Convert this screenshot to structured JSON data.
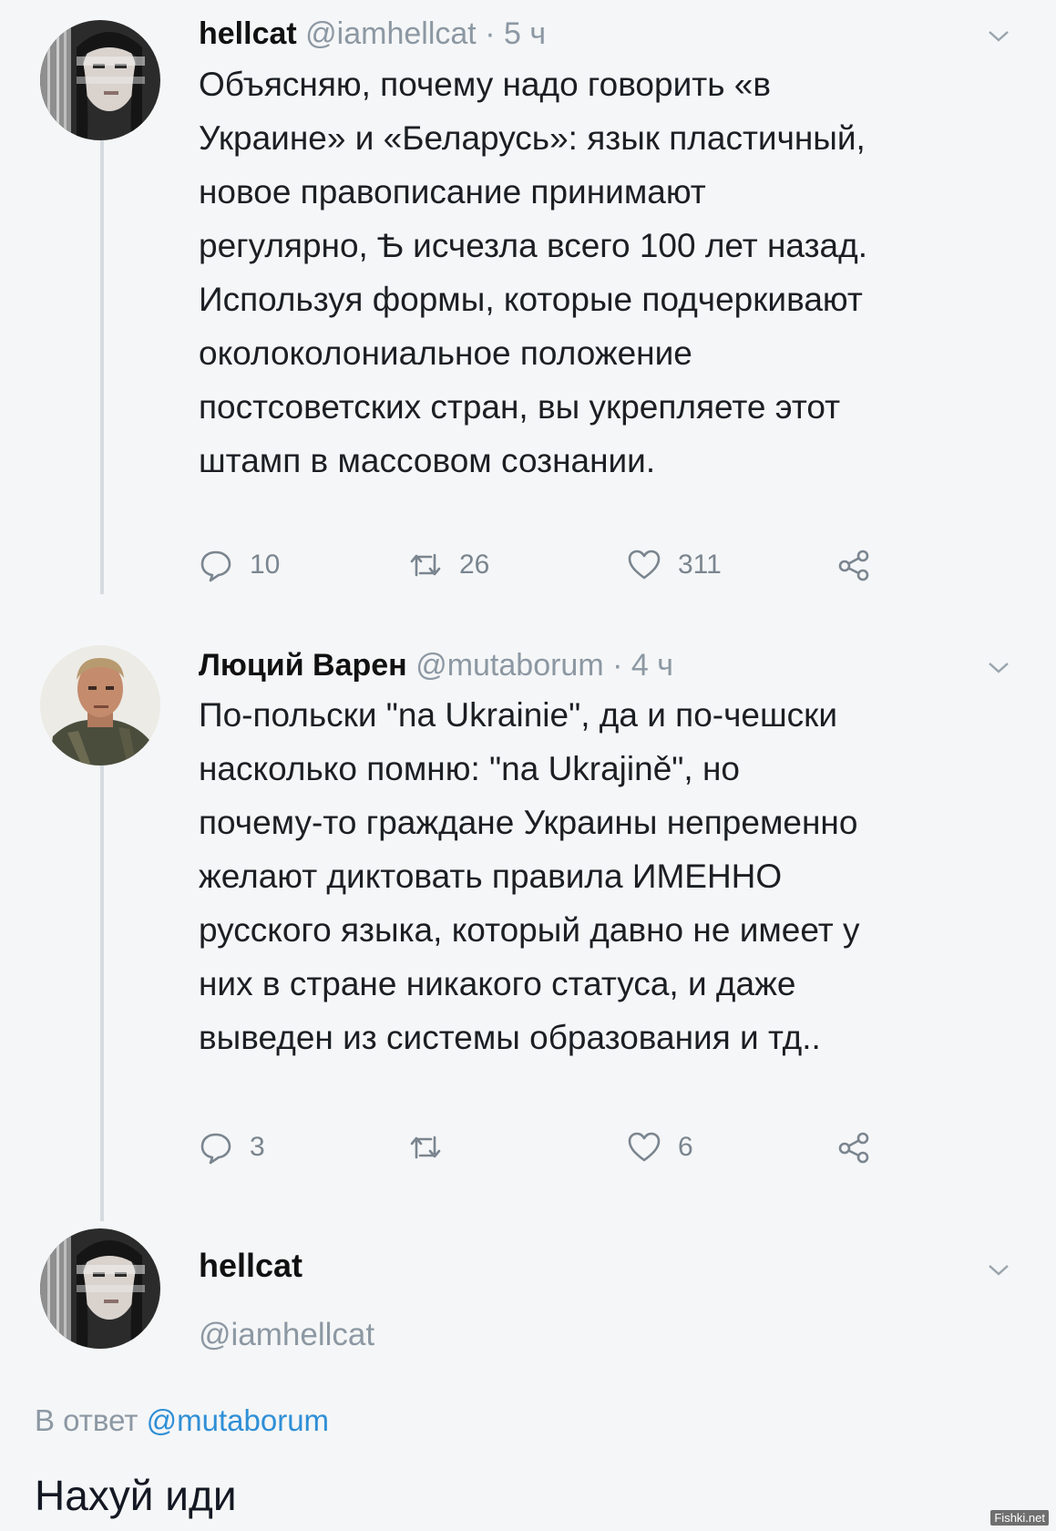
{
  "tweets": [
    {
      "name": "hellcat",
      "handle": "@iamhellcat",
      "dot": "·",
      "time": "5 ч",
      "lines": [
        "Объясняю, почему надо говорить «в",
        "Украине» и «Беларусь»: язык пластичный,",
        "новое правописание принимают",
        "регулярно, Ѣ исчезла всего 100 лет назад.",
        "Используя формы, которые подчеркивают",
        "околоколониальное положение",
        "постсоветских стран, вы укрепляете этот",
        "штамп в массовом сознании."
      ],
      "replies": "10",
      "retweets": "26",
      "likes": "311"
    },
    {
      "name": "Люций Варен",
      "handle": "@mutaborum",
      "dot": "·",
      "time": "4 ч",
      "lines": [
        "По-польски \"na Ukrainie\", да и по-чешски",
        "насколько помню: \"na Ukrajině\", но",
        "почему-то граждане Украины непременно",
        "желают диктовать правила ИМЕННО",
        "русского языка, который давно не имеет у",
        "них в стране никакого статуса, и даже",
        "выведен из системы образования и тд.."
      ],
      "replies": "3",
      "retweets": "",
      "likes": "6"
    }
  ],
  "reply": {
    "name": "hellcat",
    "handle": "@iamhellcat",
    "reply_prefix": "В ответ",
    "reply_mention": "@mutaborum",
    "text": "Нахуй иди"
  },
  "watermark": "Fishki.net",
  "colors": {
    "background": "#f5f6f7",
    "secondary_text": "#8c98a3",
    "mention": "#2f8fd6",
    "thread_line": "#d5dbe0"
  },
  "icons": [
    "reply-icon",
    "retweet-icon",
    "like-icon",
    "share-icon",
    "chevron-down-icon"
  ]
}
